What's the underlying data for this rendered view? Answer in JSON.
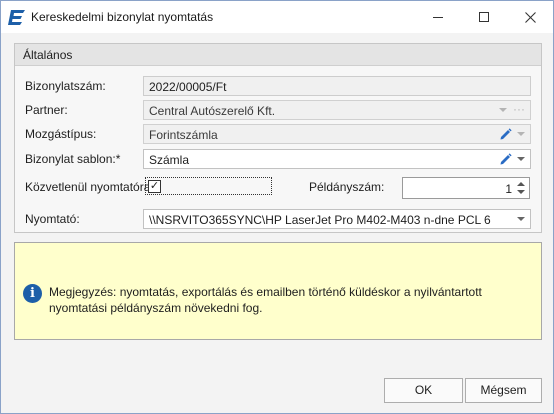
{
  "window": {
    "title": "Kereskedelmi bizonylat nyomtatás",
    "icon": "app-logo-icon",
    "controls": [
      "minimize-icon",
      "maximize-icon",
      "close-icon"
    ]
  },
  "group": {
    "title": "Általános"
  },
  "fields": {
    "document_number": {
      "label": "Bizonylatszám:",
      "value": "2022/00005/Ft"
    },
    "partner": {
      "label": "Partner:",
      "value": "Central Autószerelő Kft.",
      "ellipsis": "···"
    },
    "movement_type": {
      "label": "Mozgástípus:",
      "value": "Forintszámla"
    },
    "template": {
      "label": "Bizonylat sablon:*",
      "value": "Számla"
    },
    "print_direct": {
      "label": "Közvetlenül nyomtatóra",
      "checked": true,
      "check_glyph": "✓"
    },
    "copies": {
      "label": "Példányszám:",
      "value": "1"
    },
    "printer": {
      "label": "Nyomtató:",
      "value": "\\\\NSRVITO365SYNC\\HP LaserJet Pro M402-M403 n-dne PCL 6"
    }
  },
  "info": {
    "icon_glyph": "i",
    "text": "Megjegyzés: nyomtatás, exportálás és emailben történő küldéskor a nyilvántartott nyomtatási példányszám növekedni fog."
  },
  "buttons": {
    "ok": "OK",
    "cancel": "Mégsem"
  },
  "colors": {
    "accent": "#1d5fa8",
    "info_bg": "#ffffcc",
    "pencil_blue": "#2a6cc4"
  }
}
